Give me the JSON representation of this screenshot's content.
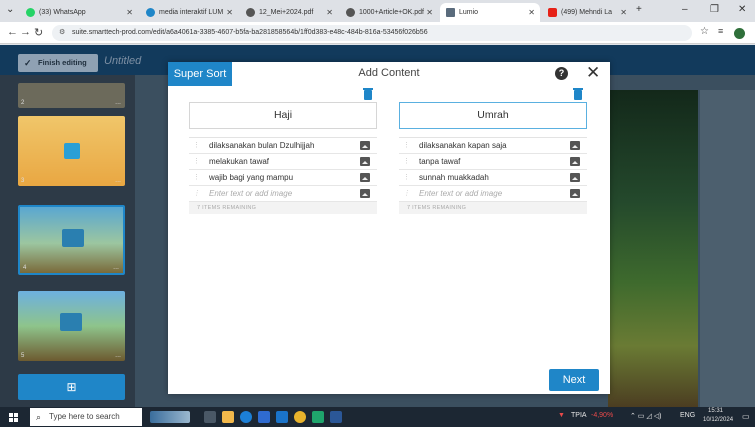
{
  "browser": {
    "tabs": [
      {
        "label": "(33) WhatsApp",
        "color": "#25d366"
      },
      {
        "label": "media interaktif LUM",
        "color": "#1f86c8"
      },
      {
        "label": "12_Mei+2024.pdf",
        "color": "#555555"
      },
      {
        "label": "1000+Article+OK.pdf",
        "color": "#555555"
      },
      {
        "label": "Lumio",
        "color": "#5a6b7c",
        "active": true
      },
      {
        "label": "(499) Mehndi La",
        "color": "#e62117"
      }
    ],
    "url": "suite.smarttech-prod.com/edit/a6a4061a-3385-4607-b5fa-ba281858564b/1ff0d383-e48c-484b-816a-53456f026b56"
  },
  "app": {
    "finish_label": "Finish editing",
    "doc_title": "Untitled",
    "slides": [
      {
        "num": "2",
        "dots": "..."
      },
      {
        "num": "3",
        "dots": "..."
      },
      {
        "num": "4",
        "dots": "..."
      },
      {
        "num": "5",
        "dots": "..."
      }
    ]
  },
  "modal": {
    "badge": "Super Sort",
    "title": "Add Content",
    "help": "?",
    "close": "✕",
    "columns": [
      {
        "heading": "Haji",
        "items": [
          "dilaksanakan bulan Dzulhijjah",
          "melakukan tawaf",
          "wajib bagi yang mampu"
        ],
        "placeholder": "Enter text or add image",
        "remaining": "7 ITEMS REMAINING"
      },
      {
        "heading": "Umrah",
        "items": [
          "dilaksanakan kapan saja",
          "tanpa tawaf",
          "sunnah muakkadah"
        ],
        "placeholder": "Enter text or add image",
        "remaining": "7 ITEMS REMAINING"
      }
    ],
    "next_label": "Next"
  },
  "taskbar": {
    "search_placeholder": "Type here to search",
    "weather": "TPIA",
    "weather_delta": "-4,90%",
    "lang": "ENG",
    "time": "15:31",
    "date": "10/12/2024"
  }
}
